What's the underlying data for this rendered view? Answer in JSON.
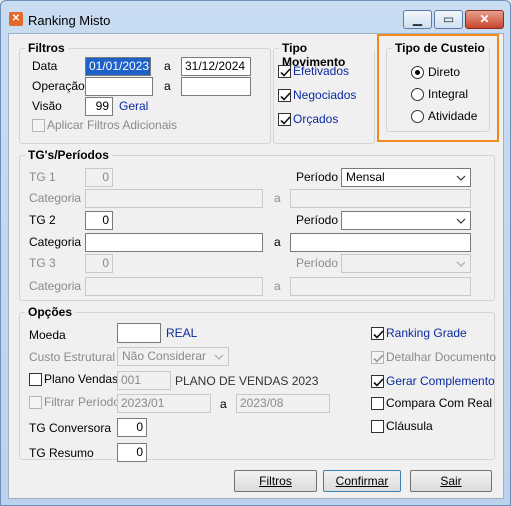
{
  "window": {
    "title": "Ranking Misto",
    "icon": "app-logo-icon"
  },
  "filtros": {
    "legend": "Filtros",
    "data_label": "Data",
    "data_from": "01/01/2023",
    "a1": "a",
    "data_to": "31/12/2024",
    "operacao_label": "Operação",
    "operacao_from": "",
    "a2": "a",
    "operacao_to": "",
    "visao_label": "Visão",
    "visao_value": "99",
    "visao_desc": "Geral",
    "aplicar_label": "Aplicar Filtros Adicionais"
  },
  "tipo_movimento": {
    "legend": "Tipo Movimento",
    "items": [
      {
        "label": "Efetivados",
        "checked": true
      },
      {
        "label": "Negociados",
        "checked": true
      },
      {
        "label": "Orçados",
        "checked": true
      }
    ]
  },
  "tipo_custeio": {
    "legend": "Tipo de Custeio",
    "options": [
      "Direto",
      "Integral",
      "Atividade"
    ],
    "selected": "Direto",
    "highlight_color": "#f08a1c"
  },
  "tg_periodos": {
    "legend": "TG's/Períodos",
    "tg1_label": "TG 1",
    "tg1_value": "0",
    "periodo1_label": "Período",
    "periodo1_value": "Mensal",
    "categoria1_label": "Categoria",
    "a1": "a",
    "tg2_label": "TG 2",
    "tg2_value": "0",
    "periodo2_label": "Período",
    "periodo2_value": "",
    "categoria2_label": "Categoria",
    "a2": "a",
    "tg3_label": "TG 3",
    "tg3_value": "0",
    "periodo3_label": "Período",
    "periodo3_value": "",
    "categoria3_label": "Categoria",
    "a3": "a"
  },
  "opcoes": {
    "legend": "Opções",
    "moeda_label": "Moeda",
    "moeda_value": "",
    "moeda_desc": "REAL",
    "custo_label": "Custo Estrutural",
    "custo_value": "Não Considerar",
    "plano_label": "Plano Vendas",
    "plano_code": "001",
    "plano_desc": "PLANO DE VENDAS 2023",
    "filtrar_label": "Filtrar Período",
    "filtrar_from": "2023/01",
    "filtrar_a": "a",
    "filtrar_to": "2023/08",
    "tg_conversora_label": "TG Conversora",
    "tg_conversora_value": "0",
    "tg_resumo_label": "TG Resumo",
    "tg_resumo_value": "0",
    "right_checks": [
      {
        "label": "Ranking Grade",
        "checked": true,
        "enabled": true
      },
      {
        "label": "Detalhar Documento",
        "checked": true,
        "enabled": false
      },
      {
        "label": "Gerar Complemento",
        "checked": true,
        "enabled": true
      },
      {
        "label": "Compara Com Real",
        "checked": false,
        "enabled": true
      },
      {
        "label": "Cláusula",
        "checked": false,
        "enabled": true
      }
    ]
  },
  "buttons": {
    "filtros": "Filtros",
    "confirmar": "Confirmar",
    "sair": "Sair"
  }
}
